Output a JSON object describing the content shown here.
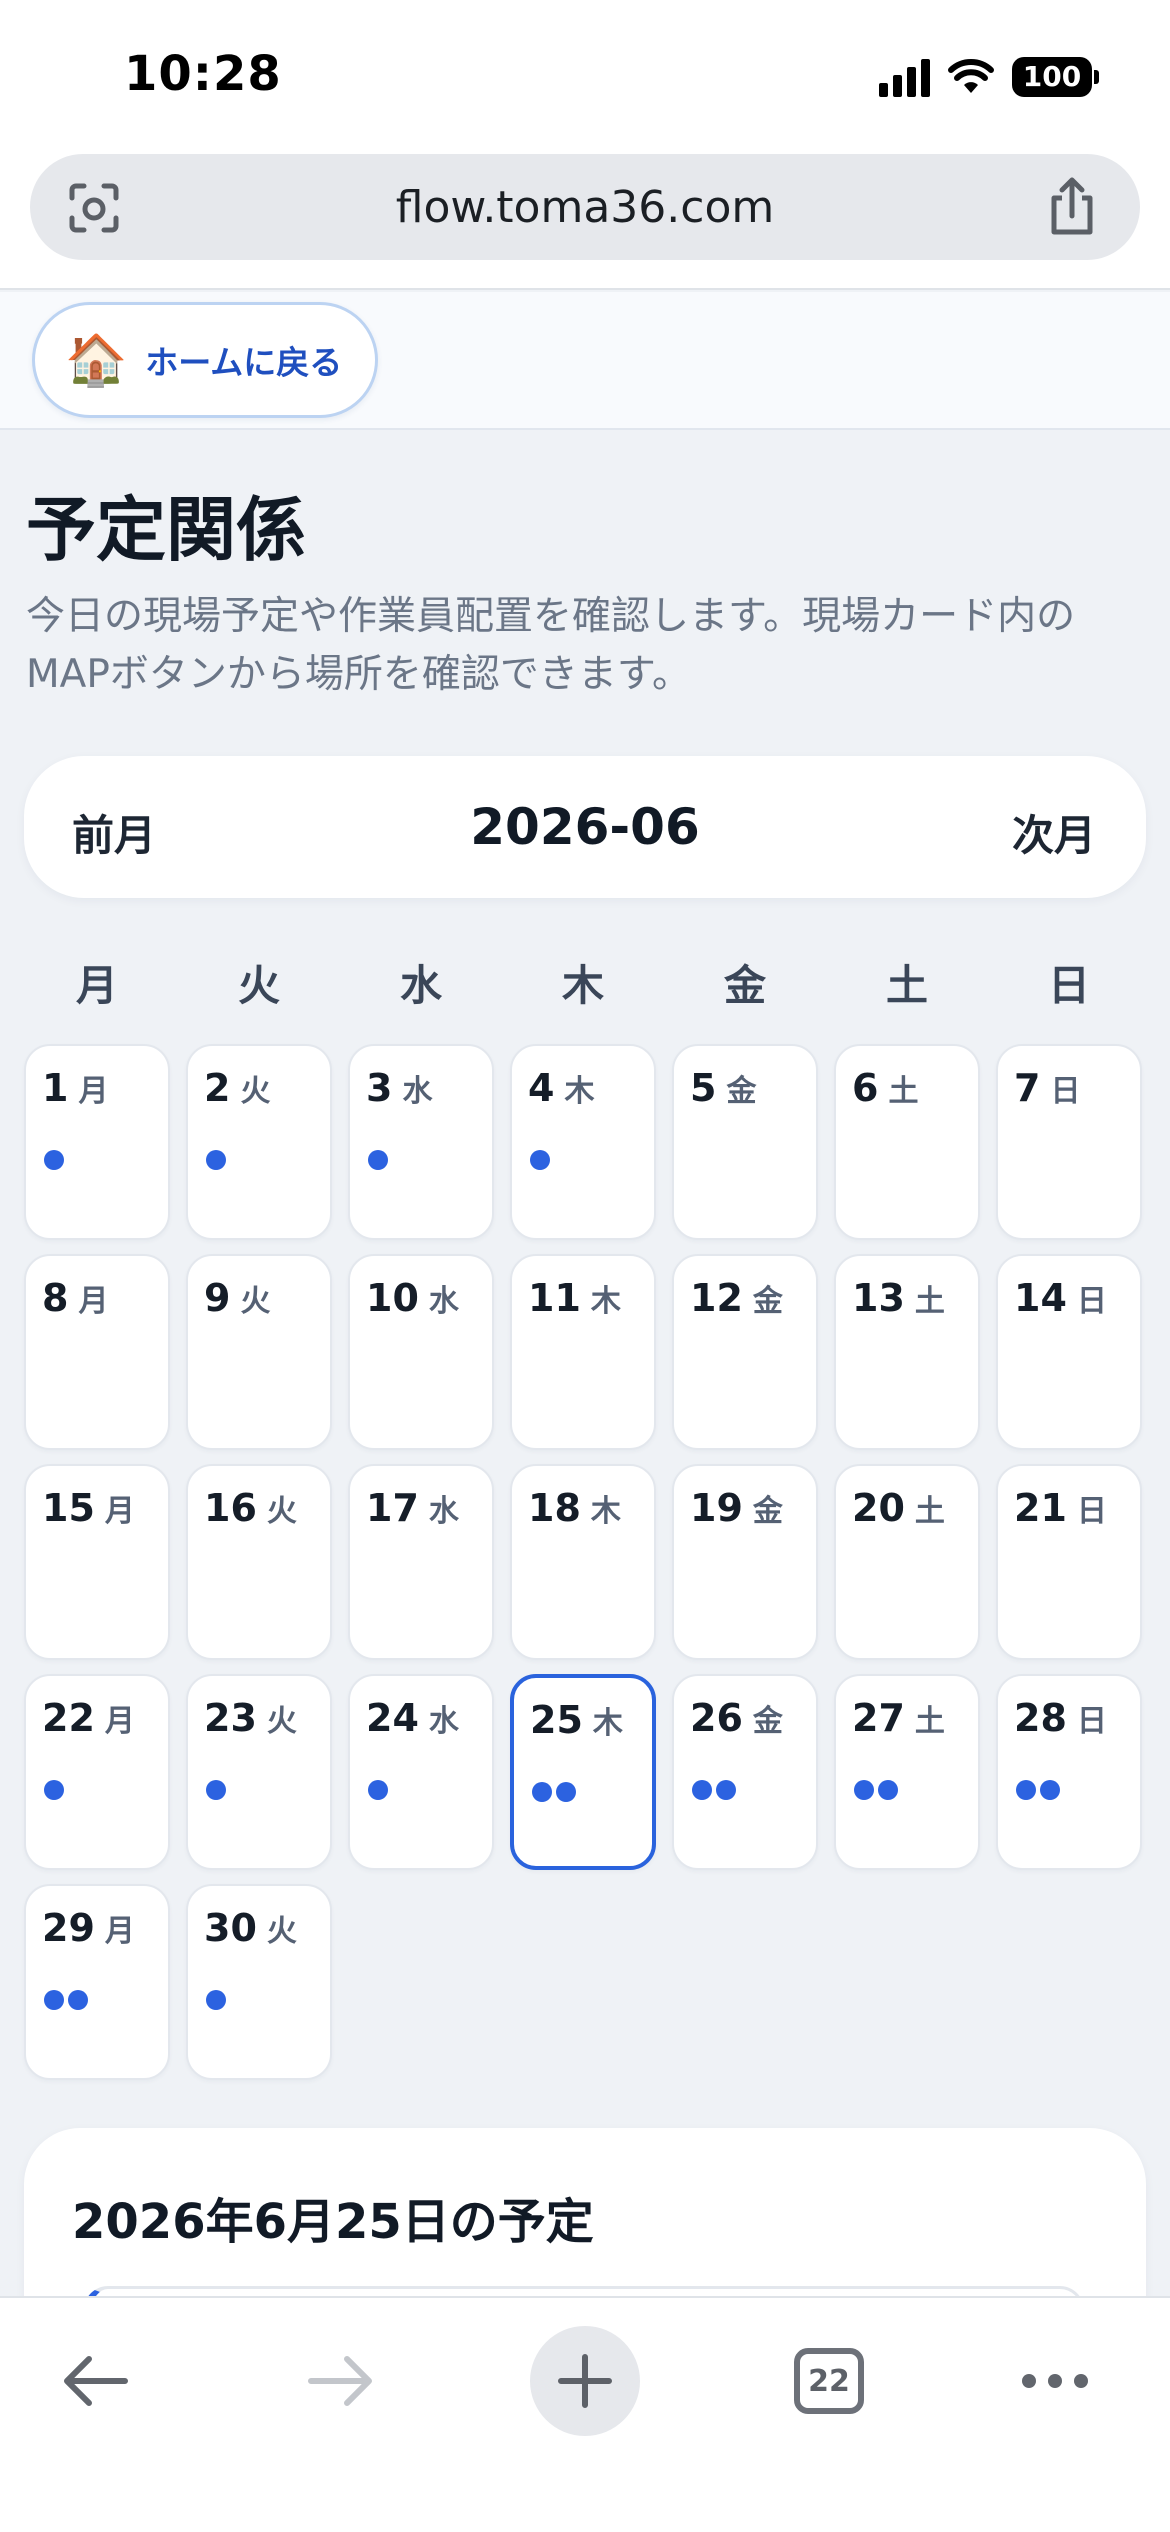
{
  "status_bar": {
    "time": "10:28",
    "battery": "100"
  },
  "browser": {
    "url": "flow.toma36.com",
    "tab_count": "22"
  },
  "home_button": {
    "emoji": "🏠",
    "label": "ホームに戻る"
  },
  "page": {
    "title": "予定関係",
    "description": "今日の現場予定や作業員配置を確認します。現場カード内のMAPボタンから場所を確認できます。"
  },
  "month_nav": {
    "prev_label": "前月",
    "current": "2026-06",
    "next_label": "次月"
  },
  "weekdays": [
    "月",
    "火",
    "水",
    "木",
    "金",
    "土",
    "日"
  ],
  "calendar": {
    "accent_color": "#2c62e0",
    "selected_day": "25",
    "days": [
      {
        "day": "1",
        "weekday": "月",
        "dots": 1
      },
      {
        "day": "2",
        "weekday": "火",
        "dots": 1
      },
      {
        "day": "3",
        "weekday": "水",
        "dots": 1
      },
      {
        "day": "4",
        "weekday": "木",
        "dots": 1
      },
      {
        "day": "5",
        "weekday": "金",
        "dots": 0
      },
      {
        "day": "6",
        "weekday": "土",
        "dots": 0
      },
      {
        "day": "7",
        "weekday": "日",
        "dots": 0
      },
      {
        "day": "8",
        "weekday": "月",
        "dots": 0
      },
      {
        "day": "9",
        "weekday": "火",
        "dots": 0
      },
      {
        "day": "10",
        "weekday": "水",
        "dots": 0
      },
      {
        "day": "11",
        "weekday": "木",
        "dots": 0
      },
      {
        "day": "12",
        "weekday": "金",
        "dots": 0
      },
      {
        "day": "13",
        "weekday": "土",
        "dots": 0
      },
      {
        "day": "14",
        "weekday": "日",
        "dots": 0
      },
      {
        "day": "15",
        "weekday": "月",
        "dots": 0
      },
      {
        "day": "16",
        "weekday": "火",
        "dots": 0
      },
      {
        "day": "17",
        "weekday": "水",
        "dots": 0
      },
      {
        "day": "18",
        "weekday": "木",
        "dots": 0
      },
      {
        "day": "19",
        "weekday": "金",
        "dots": 0
      },
      {
        "day": "20",
        "weekday": "土",
        "dots": 0
      },
      {
        "day": "21",
        "weekday": "日",
        "dots": 0
      },
      {
        "day": "22",
        "weekday": "月",
        "dots": 1
      },
      {
        "day": "23",
        "weekday": "火",
        "dots": 1
      },
      {
        "day": "24",
        "weekday": "水",
        "dots": 1
      },
      {
        "day": "25",
        "weekday": "木",
        "dots": 2
      },
      {
        "day": "26",
        "weekday": "金",
        "dots": 2
      },
      {
        "day": "27",
        "weekday": "土",
        "dots": 2
      },
      {
        "day": "28",
        "weekday": "日",
        "dots": 2
      },
      {
        "day": "29",
        "weekday": "月",
        "dots": 2
      },
      {
        "day": "30",
        "weekday": "火",
        "dots": 1
      }
    ]
  },
  "schedule": {
    "title": "2026年6月25日の予定"
  }
}
